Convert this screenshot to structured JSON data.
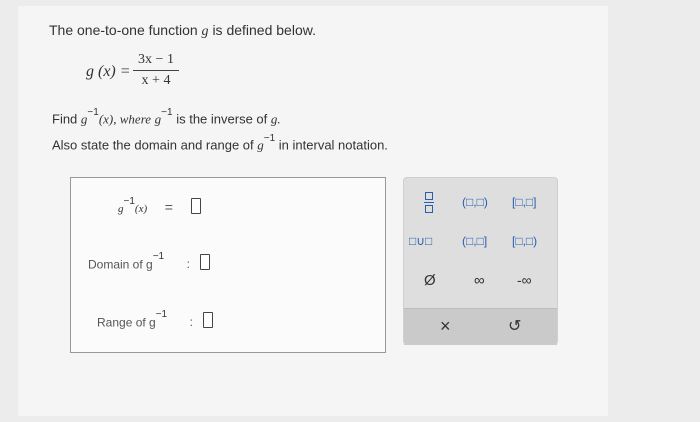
{
  "problem": {
    "intro_prefix": "The one-to-one function",
    "intro_var": "g",
    "intro_suffix": "is defined below.",
    "function_lhs": "g (x) =",
    "numerator": "3x − 1",
    "denominator": "x + 4",
    "question_line1_prefix": "Find",
    "question_g": "g",
    "question_inverse_sup": "−1",
    "question_line1_arg": "(x), where",
    "question_line1_suffix": "is the inverse of",
    "question_line1_end": "g.",
    "question_line2_prefix": "Also state the domain and range of",
    "question_line2_suffix": "in interval notation."
  },
  "answer": {
    "inverse_label": "g",
    "inverse_sup": "−1",
    "inverse_arg": "(x)",
    "inverse_eq": "=",
    "domain_label": "Domain of g",
    "domain_sup": "−1",
    "domain_sep": ":",
    "range_label": "Range of g",
    "range_sup": "−1",
    "range_sep": ":"
  },
  "keypad": {
    "open_open": "(□,□)",
    "closed_closed": "[□,□]",
    "union": "□∪□",
    "open_closed": "(□,□]",
    "closed_open": "[□,□)",
    "empty_set": "Ø",
    "infinity": "∞",
    "neg_infinity": "-∞",
    "clear": "×",
    "undo": "↺"
  },
  "colors": {
    "accent": "#2a5db0"
  }
}
